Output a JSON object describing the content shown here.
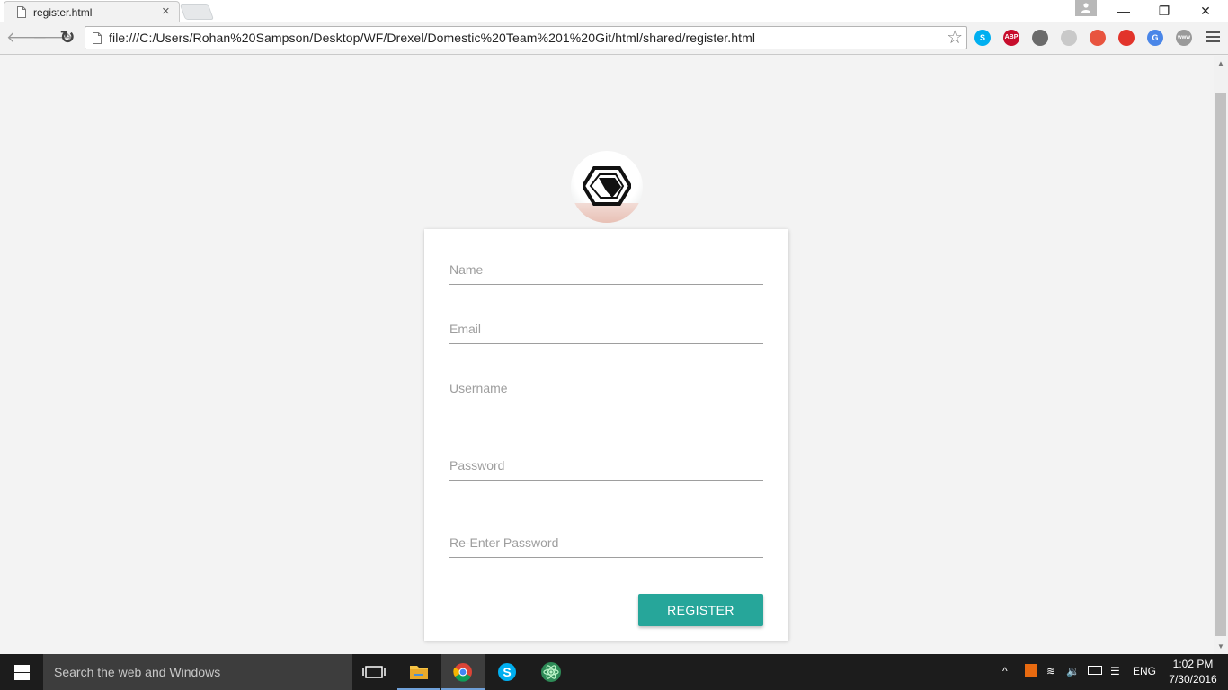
{
  "browser": {
    "tab_title": "register.html",
    "tab_close": "×",
    "url": "file:///C:/Users/Rohan%20Sampson/Desktop/WF/Drexel/Domestic%20Team%201%20Git/html/shared/register.html",
    "star_glyph": "☆",
    "back_glyph": "🡐",
    "forward_glyph": "🡒",
    "reload_glyph": "↻",
    "minimize_glyph": "—",
    "restore_glyph": "❐",
    "close_glyph": "✕",
    "extensions": [
      {
        "name": "skype-extension-icon",
        "text": "S",
        "color": "#00aff0"
      },
      {
        "name": "adblock-plus-icon",
        "text": "ABP",
        "color": "#c70d2c"
      },
      {
        "name": "lightbulb-extension-icon",
        "text": "",
        "color": "#6b6b6b"
      },
      {
        "name": "refresh-extension-icon",
        "text": "",
        "color": "#c9c9c9"
      },
      {
        "name": "blocked-extension-icon",
        "text": "",
        "color": "#e8543f"
      },
      {
        "name": "record-extension-icon",
        "text": "",
        "color": "#e2342b"
      },
      {
        "name": "google-translate-icon",
        "text": "G",
        "color": "#4a86e8"
      },
      {
        "name": "www-extension-icon",
        "text": "www",
        "color": "#9a9a9a"
      }
    ]
  },
  "form": {
    "name_placeholder": "Name",
    "email_placeholder": "Email",
    "username_placeholder": "Username",
    "password_placeholder": "Password",
    "reenter_password_placeholder": "Re-Enter Password",
    "register_label": "REGISTER",
    "accent_color": "#26a69a"
  },
  "taskbar": {
    "search_placeholder": "Search the web and Windows",
    "language": "ENG",
    "time": "1:02 PM",
    "date": "7/30/2016"
  }
}
